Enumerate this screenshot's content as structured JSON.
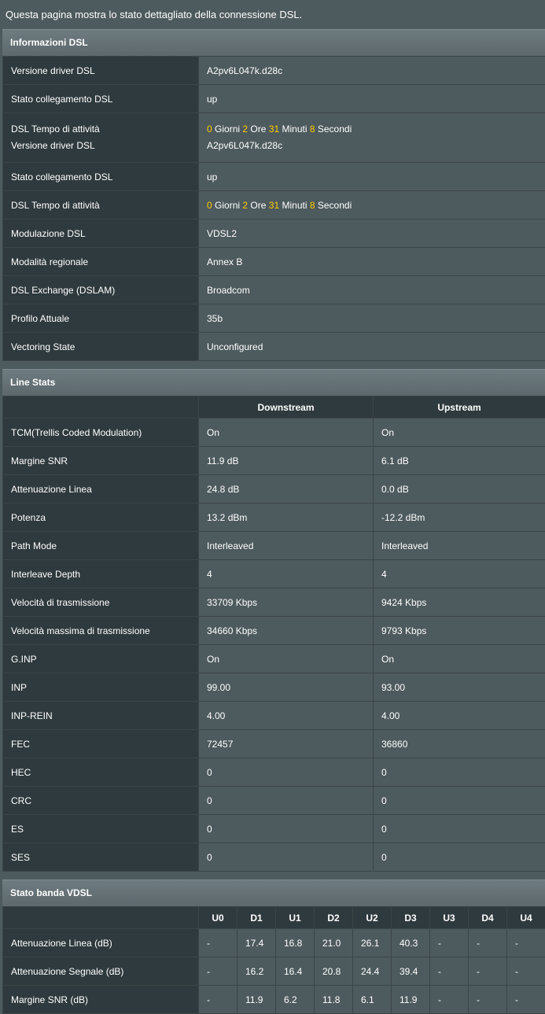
{
  "intro": "Questa pagina mostra lo stato dettagliato della connessione DSL.",
  "dsl_info": {
    "title": "Informazioni DSL",
    "rows": [
      {
        "label": "Versione driver DSL",
        "value": "A2pv6L047k.d28c"
      },
      {
        "label": "Stato collegamento DSL",
        "value": "up"
      }
    ],
    "merged": {
      "label_a": "DSL Tempo di attività",
      "label_b": "Versione driver DSL",
      "days": "0",
      "days_u": "Giorni",
      "hours": "2",
      "hours_u": "Ore",
      "mins": "31",
      "mins_u": "Minuti",
      "secs": "8",
      "secs_u": "Secondi",
      "value_b": "A2pv6L047k.d28c"
    },
    "rows2": [
      {
        "label": "Stato collegamento DSL",
        "value": "up"
      }
    ],
    "uptime": {
      "label": "DSL Tempo di attività",
      "days": "0",
      "days_u": "Giorni",
      "hours": "2",
      "hours_u": "Ore",
      "mins": "31",
      "mins_u": "Minuti",
      "secs": "8",
      "secs_u": "Secondi"
    },
    "rows3": [
      {
        "label": "Modulazione DSL",
        "value": "VDSL2"
      },
      {
        "label": "Modalità regionale",
        "value": "Annex B"
      },
      {
        "label": "DSL Exchange (DSLAM)",
        "value": "Broadcom"
      },
      {
        "label": "Profilo Attuale",
        "value": "35b"
      },
      {
        "label": "Vectoring State",
        "value": "Unconfigured"
      }
    ]
  },
  "line_stats": {
    "title": "Line Stats",
    "col_down": "Downstream",
    "col_up": "Upstream",
    "rows": [
      {
        "label": "TCM(Trellis Coded Modulation)",
        "down": "On",
        "up": "On"
      },
      {
        "label": "Margine SNR",
        "down": "11.9 dB",
        "up": "6.1 dB"
      },
      {
        "label": "Attenuazione Linea",
        "down": "24.8 dB",
        "up": "0.0 dB"
      },
      {
        "label": "Potenza",
        "down": "13.2 dBm",
        "up": "-12.2 dBm"
      },
      {
        "label": "Path Mode",
        "down": "Interleaved",
        "up": "Interleaved"
      },
      {
        "label": "Interleave Depth",
        "down": "4",
        "up": "4"
      },
      {
        "label": "Velocità di trasmissione",
        "down": "33709 Kbps",
        "up": "9424 Kbps"
      },
      {
        "label": "Velocità massima di trasmissione",
        "down": "34660 Kbps",
        "up": "9793 Kbps"
      },
      {
        "label": "G.INP",
        "down": "On",
        "up": "On"
      },
      {
        "label": "INP",
        "down": "99.00",
        "up": "93.00"
      },
      {
        "label": "INP-REIN",
        "down": "4.00",
        "up": "4.00"
      },
      {
        "label": "FEC",
        "down": "72457",
        "up": "36860"
      },
      {
        "label": "HEC",
        "down": "0",
        "up": "0"
      },
      {
        "label": "CRC",
        "down": "0",
        "up": "0"
      },
      {
        "label": "ES",
        "down": "0",
        "up": "0"
      },
      {
        "label": "SES",
        "down": "0",
        "up": "0"
      }
    ]
  },
  "vdsl_band": {
    "title": "Stato banda VDSL",
    "bands": [
      "U0",
      "D1",
      "U1",
      "D2",
      "U2",
      "D3",
      "U3",
      "D4",
      "U4"
    ],
    "rows": [
      {
        "label": "Attenuazione Linea (dB)",
        "values": [
          "-",
          "17.4",
          "16.8",
          "21.0",
          "26.1",
          "40.3",
          "-",
          "-",
          "-"
        ]
      },
      {
        "label": "Attenuazione Segnale (dB)",
        "values": [
          "-",
          "16.2",
          "16.4",
          "20.8",
          "24.4",
          "39.4",
          "-",
          "-",
          "-"
        ]
      },
      {
        "label": "Margine SNR (dB)",
        "values": [
          "-",
          "11.9",
          "6.2",
          "11.8",
          "6.1",
          "11.9",
          "-",
          "-",
          "-"
        ]
      }
    ]
  },
  "colors": {
    "highlight": "#ffcc00",
    "downstream": "#ff9933",
    "upstream": "#55b7ff"
  }
}
